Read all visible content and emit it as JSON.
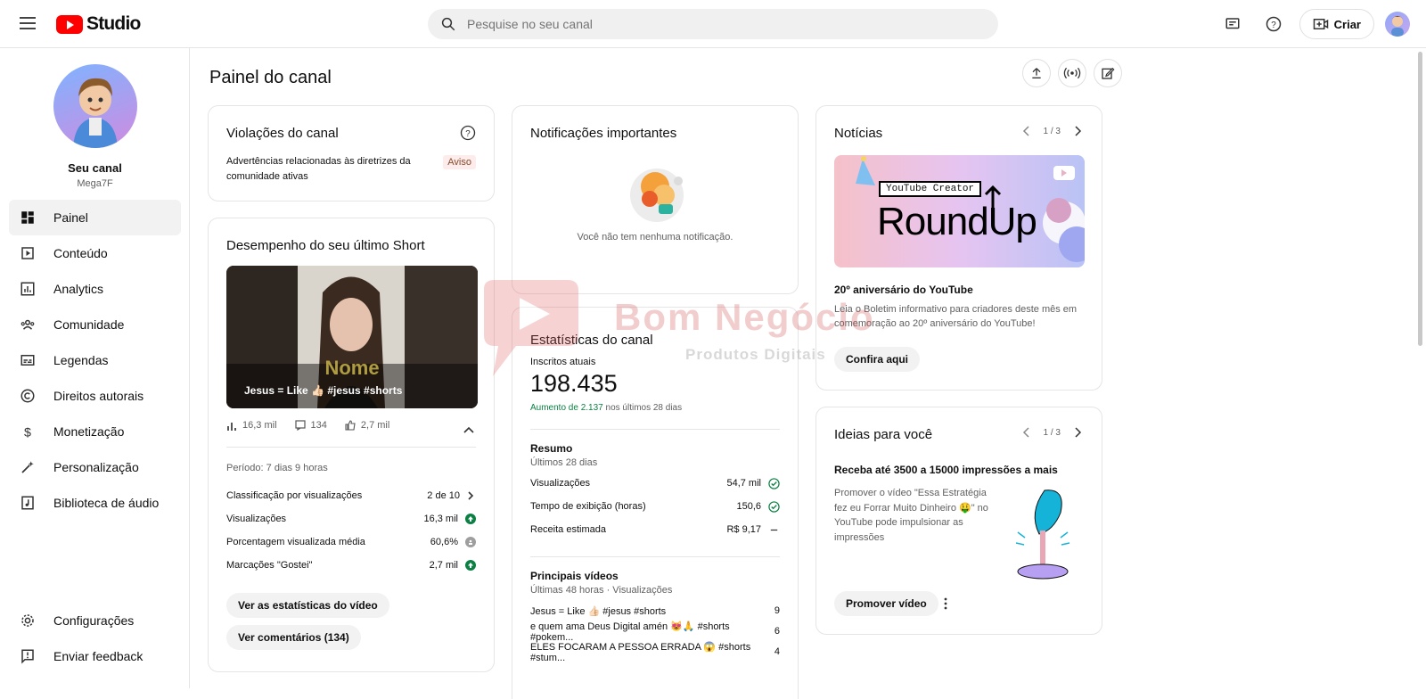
{
  "header": {
    "brand": "Studio",
    "search_placeholder": "Pesquise no seu canal",
    "create_label": "Criar",
    "icons": [
      "menu-icon",
      "youtube-logo-icon",
      "search-icon",
      "subtitles-icon",
      "help-icon",
      "create-video-icon",
      "account-avatar"
    ]
  },
  "sidebar": {
    "channel_label": "Seu canal",
    "channel_name": "Mega7F",
    "items": [
      {
        "label": "Painel",
        "icon": "dashboard-icon",
        "active": true
      },
      {
        "label": "Conteúdo",
        "icon": "content-icon"
      },
      {
        "label": "Analytics",
        "icon": "analytics-icon"
      },
      {
        "label": "Comunidade",
        "icon": "community-icon"
      },
      {
        "label": "Legendas",
        "icon": "subtitles-icon"
      },
      {
        "label": "Direitos autorais",
        "icon": "copyright-icon"
      },
      {
        "label": "Monetização",
        "icon": "dollar-icon"
      },
      {
        "label": "Personalização",
        "icon": "wand-icon"
      },
      {
        "label": "Biblioteca de áudio",
        "icon": "audio-library-icon"
      }
    ],
    "footer": [
      {
        "label": "Configurações",
        "icon": "gear-icon"
      },
      {
        "label": "Enviar feedback",
        "icon": "feedback-icon"
      }
    ]
  },
  "page": {
    "title": "Painel do canal"
  },
  "violations": {
    "title": "Violações do canal",
    "text": "Advertências relacionadas às diretrizes da comunidade ativas",
    "badge": "Aviso"
  },
  "short": {
    "title": "Desempenho do seu último Short",
    "video_title": "Jesus = Like 👍🏻 #jesus #shorts",
    "overlay_word": "Nome",
    "views": "16,3 mil",
    "comments": "134",
    "likes": "2,7 mil",
    "period": "Período: 7 dias 9 horas",
    "rows": [
      {
        "label": "Classificação por visualizações",
        "value": "2 de 10"
      },
      {
        "label": "Visualizações",
        "value": "16,3 mil"
      },
      {
        "label": "Porcentagem visualizada média",
        "value": "60,6%"
      },
      {
        "label": "Marcações \"Gostei\"",
        "value": "2,7 mil"
      }
    ],
    "btn_stats": "Ver as estatísticas do vídeo",
    "btn_comments": "Ver comentários (134)"
  },
  "notifications": {
    "title": "Notificações importantes",
    "empty": "Você não tem nenhuma notificação."
  },
  "stats": {
    "title": "Estatísticas do canal",
    "subs_label": "Inscritos atuais",
    "subs_value": "198.435",
    "growth_green": "Aumento de 2.137",
    "growth_rest": "nos últimos 28 dias",
    "summary_title": "Resumo",
    "summary_sub": "Últimos 28 dias",
    "summary": [
      {
        "label": "Visualizações",
        "value": "54,7 mil"
      },
      {
        "label": "Tempo de exibição (horas)",
        "value": "150,6"
      },
      {
        "label": "Receita estimada",
        "value": "R$ 9,17"
      }
    ],
    "top_title": "Principais vídeos",
    "top_sub": "Últimas 48 horas · Visualizações",
    "top": [
      {
        "title": "Jesus = Like 👍🏻 #jesus #shorts",
        "value": "9"
      },
      {
        "title": "e quem ama Deus Digital amén 😻🙏 #shorts #pokem...",
        "value": "6"
      },
      {
        "title": "ELES FOCARAM A PESSOA ERRADA 😱 #shorts #stum...",
        "value": "4"
      }
    ]
  },
  "news": {
    "title": "Notícias",
    "pager": "1 / 3",
    "banner_small": "YouTube Creator",
    "banner_big": "RoundUp",
    "headline": "20º aniversário do YouTube",
    "text": "Leia o Boletim informativo para criadores deste mês em comemoração ao 20º aniversário do YouTube!",
    "cta": "Confira aqui"
  },
  "ideas": {
    "title": "Ideias para você",
    "pager": "1 / 3",
    "headline": "Receba até 3500 a 15000 impressões a mais",
    "text": "Promover o vídeo \"Essa Estratégia fez eu Forrar Muito Dinheiro 🤑\" no YouTube pode impulsionar as impressões",
    "cta": "Promover vídeo"
  },
  "watermark": {
    "line1": "Bom Negócio",
    "line2": "Produtos Digitais"
  },
  "colors": {
    "accent_red": "#ff0000",
    "green": "#0b8043",
    "badge_bg": "#fdecec",
    "badge_text": "#8a4b2a"
  }
}
